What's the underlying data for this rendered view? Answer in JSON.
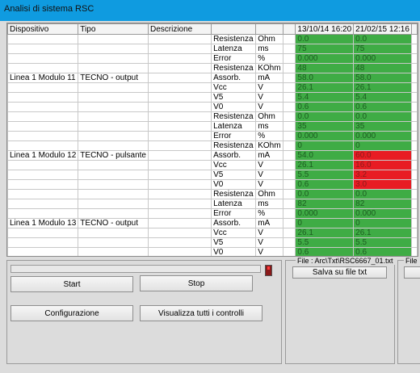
{
  "window": {
    "title": "Analisi di sistema RSC"
  },
  "grid": {
    "headers": [
      "Dispositivo",
      "Tipo",
      "Descrizione",
      "",
      "",
      "",
      "13/10/14 16:20",
      "21/02/15 12:16"
    ],
    "rows": [
      {
        "dev": "",
        "tipo": "",
        "param": "Resistenza",
        "unit": "Ohm",
        "v1": "0.0",
        "s1": "ok",
        "v2": "0.0",
        "s2": "ok"
      },
      {
        "dev": "",
        "tipo": "",
        "param": "Latenza",
        "unit": "ms",
        "v1": "75",
        "s1": "ok",
        "v2": "75",
        "s2": "ok"
      },
      {
        "dev": "",
        "tipo": "",
        "param": "Error",
        "unit": "%",
        "v1": "0.000",
        "s1": "ok",
        "v2": "0.000",
        "s2": "ok"
      },
      {
        "dev": "",
        "tipo": "",
        "param": "Resistenza",
        "unit": "KOhm",
        "v1": "48",
        "s1": "ok",
        "v2": "48",
        "s2": "ok"
      },
      {
        "dev": "Linea 1 Modulo 11",
        "tipo": "TECNO - output",
        "param": "Assorb.",
        "unit": "mA",
        "v1": "58.0",
        "s1": "ok",
        "v2": "58.0",
        "s2": "ok"
      },
      {
        "dev": "",
        "tipo": "",
        "param": "Vcc",
        "unit": "V",
        "v1": "26.1",
        "s1": "ok",
        "v2": "26.1",
        "s2": "ok"
      },
      {
        "dev": "",
        "tipo": "",
        "param": "V5",
        "unit": "V",
        "v1": "5.4",
        "s1": "ok",
        "v2": "5.4",
        "s2": "ok"
      },
      {
        "dev": "",
        "tipo": "",
        "param": "V0",
        "unit": "V",
        "v1": "0.6",
        "s1": "ok",
        "v2": "0.6",
        "s2": "ok"
      },
      {
        "dev": "",
        "tipo": "",
        "param": "Resistenza",
        "unit": "Ohm",
        "v1": "0.0",
        "s1": "ok",
        "v2": "0.0",
        "s2": "ok"
      },
      {
        "dev": "",
        "tipo": "",
        "param": "Latenza",
        "unit": "ms",
        "v1": "35",
        "s1": "ok",
        "v2": "35",
        "s2": "ok"
      },
      {
        "dev": "",
        "tipo": "",
        "param": "Error",
        "unit": "%",
        "v1": "0.000",
        "s1": "ok",
        "v2": "0.000",
        "s2": "ok"
      },
      {
        "dev": "",
        "tipo": "",
        "param": "Resistenza",
        "unit": "KOhm",
        "v1": "0",
        "s1": "ok",
        "v2": "0",
        "s2": "ok"
      },
      {
        "dev": "Linea 1 Modulo 12",
        "tipo": "TECNO - pulsante",
        "param": "Assorb.",
        "unit": "mA",
        "v1": "54.0",
        "s1": "ok",
        "v2": "60.0",
        "s2": "bad"
      },
      {
        "dev": "",
        "tipo": "",
        "param": "Vcc",
        "unit": "V",
        "v1": "26.1",
        "s1": "ok",
        "v2": "16.0",
        "s2": "bad"
      },
      {
        "dev": "",
        "tipo": "",
        "param": "V5",
        "unit": "V",
        "v1": "5.5",
        "s1": "ok",
        "v2": "3.2",
        "s2": "bad"
      },
      {
        "dev": "",
        "tipo": "",
        "param": "V0",
        "unit": "V",
        "v1": "0.6",
        "s1": "ok",
        "v2": "3.0",
        "s2": "bad"
      },
      {
        "dev": "",
        "tipo": "",
        "param": "Resistenza",
        "unit": "Ohm",
        "v1": "0.0",
        "s1": "ok",
        "v2": "0.0",
        "s2": "ok"
      },
      {
        "dev": "",
        "tipo": "",
        "param": "Latenza",
        "unit": "ms",
        "v1": "82",
        "s1": "ok",
        "v2": "82",
        "s2": "ok"
      },
      {
        "dev": "",
        "tipo": "",
        "param": "Error",
        "unit": "%",
        "v1": "0.000",
        "s1": "ok",
        "v2": "0.000",
        "s2": "ok"
      },
      {
        "dev": "Linea 1 Modulo 13",
        "tipo": "TECNO - output",
        "param": "Assorb.",
        "unit": "mA",
        "v1": "0",
        "s1": "ok",
        "v2": "0",
        "s2": "ok"
      },
      {
        "dev": "",
        "tipo": "",
        "param": "Vcc",
        "unit": "V",
        "v1": "26.1",
        "s1": "ok",
        "v2": "26.1",
        "s2": "ok"
      },
      {
        "dev": "",
        "tipo": "",
        "param": "V5",
        "unit": "V",
        "v1": "5.5",
        "s1": "ok",
        "v2": "5.5",
        "s2": "ok"
      },
      {
        "dev": "",
        "tipo": "",
        "param": "V0",
        "unit": "V",
        "v1": "0.6",
        "s1": "ok",
        "v2": "0.6",
        "s2": "ok"
      }
    ]
  },
  "controls": {
    "start_label": "Start",
    "stop_label": "Stop",
    "config_label": "Configurazione",
    "show_all_label": "Visualizza tutti i controlli",
    "progress": 0
  },
  "files": {
    "file1_label": "File : Arc\\Txt\\RSC6667_01.txt",
    "save_label": "Salva su file txt",
    "file2_label": "File :"
  },
  "colors": {
    "ok": "#3fac45",
    "bad": "#e81c23",
    "titlebar": "#0f9be0"
  }
}
